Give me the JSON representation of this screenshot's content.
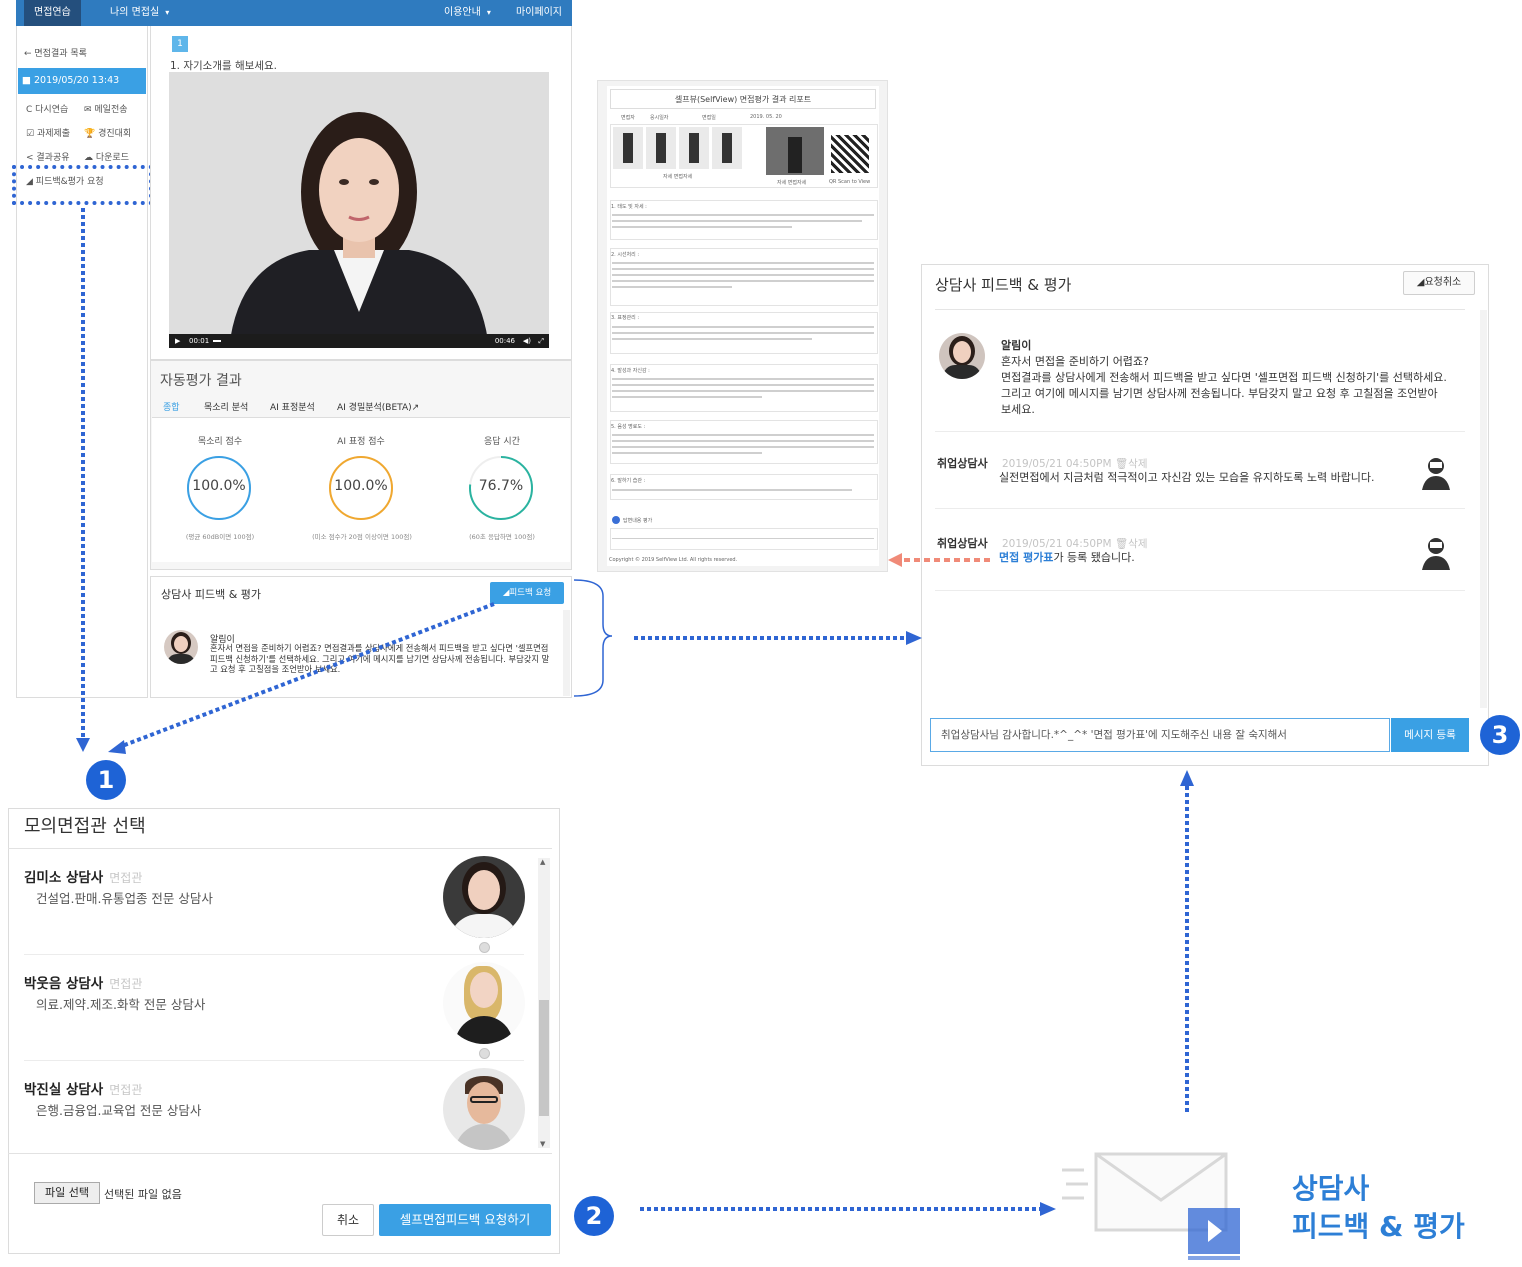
{
  "nav": {
    "tab_practice": "면접연습",
    "tab_my": "나의 면접실",
    "tab_guide": "이용안내",
    "tab_mypage": "마이페이지"
  },
  "sidebar": {
    "back": "← 면접결과 목록",
    "date": "2019/05/20 13:43",
    "retry": "다시연습",
    "mail": "메일전송",
    "assign": "과제제출",
    "contest": "경진대회",
    "share": "결과공유",
    "download": "다운로드",
    "feedback_request": "피드백&평가 요청"
  },
  "video": {
    "question_no": "1",
    "question": "1. 자기소개를 해보세요.",
    "time_current": "00:01",
    "time_total": "00:46"
  },
  "auto_eval": {
    "title": "자동평가 결과",
    "tabs": [
      "종합",
      "목소리 분석",
      "AI 표정분석",
      "AI 경밀분석(BETA)"
    ],
    "scores": [
      {
        "label": "목소리 점수",
        "value": "100.0%",
        "pct": 100,
        "color": "#3aa0e4",
        "note": "(평균 60dB이면 100점)"
      },
      {
        "label": "AI 표정 점수",
        "value": "100.0%",
        "pct": 100,
        "color": "#f0a830",
        "note": "(미소 점수가 20점 이상이면 100점)"
      },
      {
        "label": "응답 시간",
        "value": "76.7%",
        "pct": 76.7,
        "color": "#2ab3a0",
        "note": "(60초 응답하면 100점)"
      }
    ]
  },
  "fb_small": {
    "title": "상담사 피드백 & 평가",
    "button": "피드백 요청",
    "name": "알림이",
    "text": "혼자서 면접을 준비하기 어렵죠? 면접결과를 상담사에게 전송해서 피드백을 받고 싶다면 '셀프면접 피드백 신청하기'를 선택하세요. 그리고 여기에 메시지를 남기면 상담사께 전송됩니다. 부담갖지 말고 요청 후 고칠점을 조언받아 보세요."
  },
  "report": {
    "title": "셀프뷰(SelfView) 면접평가 결과 리포트",
    "meta": [
      "면접자",
      "응시일자",
      "면접일",
      "2019. 05. 20"
    ],
    "photo_caption": "자세 면접자세",
    "qr_caption": "QR Scan to View",
    "sections": [
      "1. 태도 및 자세 :",
      "2. 시선처리 :",
      "3. 표정관리 :",
      "4. 발성과 자신감 :",
      "5. 음성 명료도 :",
      "6. 말하기 습관 :"
    ],
    "answer_title": "답변내용 평가",
    "footer": "Copyright © 2019 SelfView Ltd. All rights reserved."
  },
  "fb_big": {
    "title": "상담사 피드백 & 평가",
    "cancel": "요청취소",
    "msg1_name": "알림이",
    "msg1_lines": [
      "혼자서 면접을 준비하기 어렵죠?",
      "면접결과를 상담사에게 전송해서 피드백을 받고 싶다면 '셀프면접 피드백 신청하기'를 선택하세요.",
      "그리고 여기에 메시지를 남기면 상담사께 전송됩니다. 부담갖지 말고 요청 후 고칠점을 조언받아",
      "보세요."
    ],
    "msg2_name": "취업상담사",
    "msg2_meta": "2019/05/21 04:50PM 🗑삭제",
    "msg2_text": "실전면접에서 지금처럼 적극적이고 자신감 있는 모습을 유지하도록 노력 바랍니다.",
    "msg3_name": "취업상담사",
    "msg3_meta": "2019/05/21 04:50PM 🗑삭제",
    "msg3_link": "면접 평가표",
    "msg3_text": "가 등록 됐습니다.",
    "input_value": "취업상담사님 감사합니다.*^_^* '면접 평가표'에 지도해주신 내용 잘 숙지해서",
    "submit": "메시지 등록"
  },
  "select": {
    "title": "모의면접관 선택",
    "counselors": [
      {
        "name": "김미소 상담사",
        "role": "면접관",
        "desc": "건설업.판매.유통업종 전문 상담사"
      },
      {
        "name": "박웃음 상담사",
        "role": "면접관",
        "desc": "의료.제약.제조.화학 전문 상담사"
      },
      {
        "name": "박진실 상담사",
        "role": "면접관",
        "desc": "은행.금융업.교육업 전문 상담사"
      }
    ],
    "file_button": "파일 선택",
    "file_text": "선택된 파일 없음",
    "cancel": "취소",
    "submit": "셀프면접피드백 요청하기"
  },
  "steps": [
    "1",
    "2",
    "3"
  ],
  "final_label_1": "상담사",
  "final_label_2": "피드백 & 평가"
}
